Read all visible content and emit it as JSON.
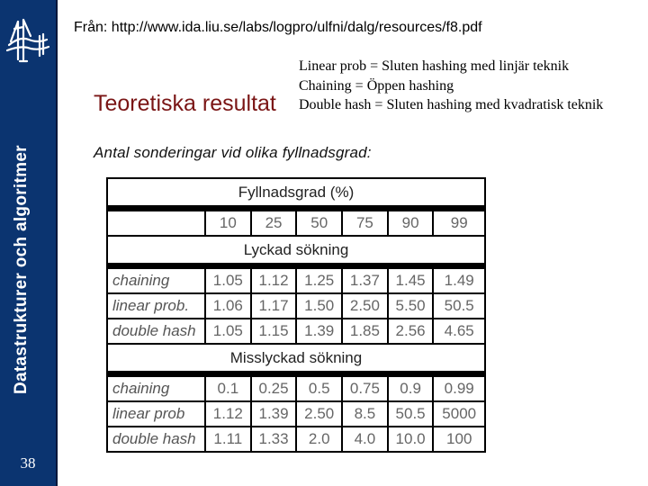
{
  "sidebar": {
    "logo_icon": "bridge-logo-icon",
    "vertical_title": "Datastrukturer och algoritmer",
    "slide_number": "38"
  },
  "source_line": "Från: http://www.ida.liu.se/labs/logpro/ulfni/dalg/resources/f8.pdf",
  "notes": [
    "Linear prob = Sluten hashing med linjär teknik",
    "Chaining = Öppen hashing",
    "Double hash = Sluten hashing med kvadratisk teknik"
  ],
  "heading": "Teoretiska resultat",
  "subheading": "Antal sonderingar vid olika fyllnadsgrad:",
  "table": {
    "title": "Fyllnadsgrad (%)",
    "columns": [
      "10",
      "25",
      "50",
      "75",
      "90",
      "99"
    ],
    "sections": [
      {
        "label": "Lyckad sökning",
        "rows": [
          {
            "name": "chaining",
            "values": [
              "1.05",
              "1.12",
              "1.25",
              "1.37",
              "1.45",
              "1.49"
            ]
          },
          {
            "name": "linear prob.",
            "values": [
              "1.06",
              "1.17",
              "1.50",
              "2.50",
              "5.50",
              "50.5"
            ]
          },
          {
            "name": "double hash",
            "values": [
              "1.05",
              "1.15",
              "1.39",
              "1.85",
              "2.56",
              "4.65"
            ]
          }
        ]
      },
      {
        "label": "Misslyckad sökning",
        "rows": [
          {
            "name": "chaining",
            "values": [
              "0.1",
              "0.25",
              "0.5",
              "0.75",
              "0.9",
              "0.99"
            ]
          },
          {
            "name": "linear prob",
            "values": [
              "1.12",
              "1.39",
              "2.50",
              "8.5",
              "50.5",
              "5000"
            ]
          },
          {
            "name": "double hash",
            "values": [
              "1.11",
              "1.33",
              "2.0",
              "4.0",
              "10.0",
              "100"
            ]
          }
        ]
      }
    ]
  }
}
